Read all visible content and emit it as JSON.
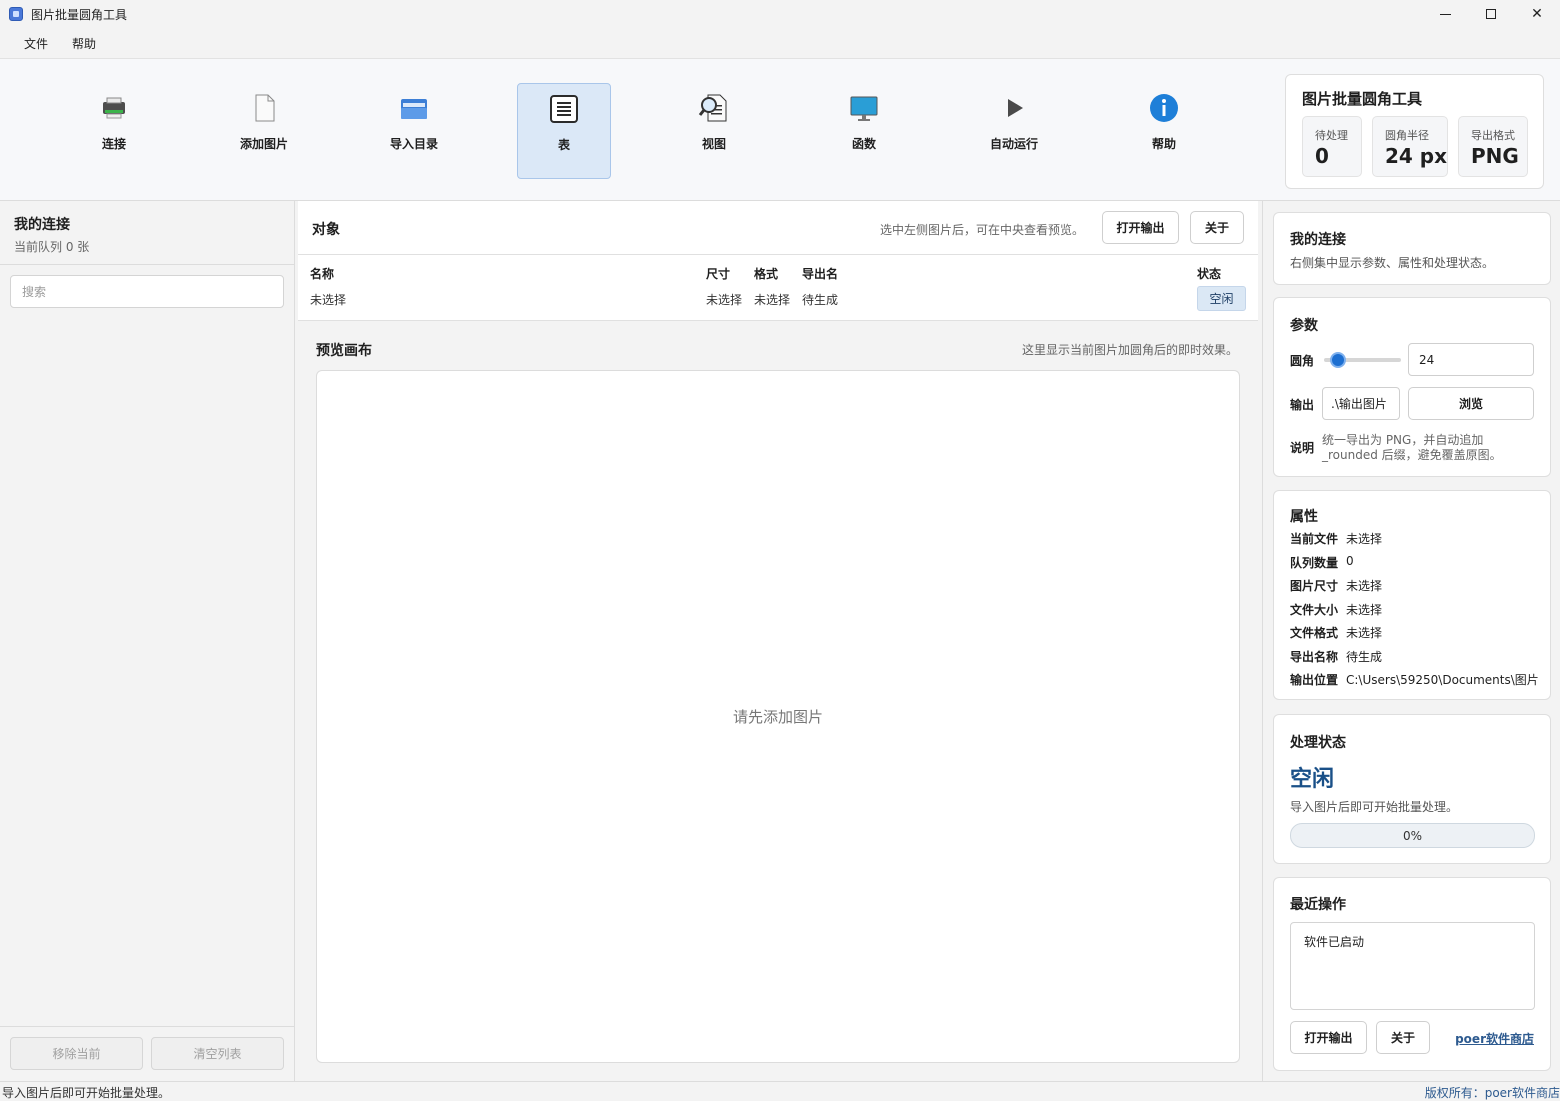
{
  "window": {
    "title": "图片批量圆角工具"
  },
  "menu": [
    "文件",
    "帮助"
  ],
  "toolbar": {
    "items": [
      {
        "label": "连接",
        "icon": "printer-icon"
      },
      {
        "label": "添加图片",
        "icon": "document-icon"
      },
      {
        "label": "导入目录",
        "icon": "folder-icon"
      },
      {
        "label": "表",
        "icon": "table-icon"
      },
      {
        "label": "视图",
        "icon": "magnifier-document-icon"
      },
      {
        "label": "函数",
        "icon": "monitor-icon"
      },
      {
        "label": "自动运行",
        "icon": "play-icon"
      },
      {
        "label": "帮助",
        "icon": "info-icon"
      }
    ],
    "active_index": 3
  },
  "summary": {
    "title": "图片批量圆角工具",
    "stats": [
      {
        "label": "待处理",
        "value": "0"
      },
      {
        "label": "圆角半径",
        "value": "24 px"
      },
      {
        "label": "导出格式",
        "value": "PNG"
      }
    ]
  },
  "left": {
    "title": "我的连接",
    "subtitle": "当前队列 0 张",
    "search_placeholder": "搜索",
    "remove_label": "移除当前",
    "clear_label": "清空列表"
  },
  "objects": {
    "title": "对象",
    "hint": "选中左侧图片后，可在中央查看预览。",
    "open_output_label": "打开输出",
    "about_label": "关于",
    "columns": [
      "名称",
      "尺寸",
      "格式",
      "导出名",
      "状态"
    ],
    "row": {
      "name": "未选择",
      "size": "未选择",
      "format": "未选择",
      "export_name": "待生成",
      "status": "空闲"
    }
  },
  "preview": {
    "title": "预览画布",
    "hint": "这里显示当前图片加圆角后的即时效果。",
    "empty_text": "请先添加图片"
  },
  "right": {
    "conn": {
      "title": "我的连接",
      "subtitle": "右侧集中显示参数、属性和处理状态。"
    },
    "params": {
      "title": "参数",
      "radius_label": "圆角",
      "radius_value": "24",
      "radius_fraction": 0.1,
      "output_label": "输出",
      "output_value": ".\\输出图片",
      "browse_label": "浏览",
      "note_label": "说明",
      "note_line1": "统一导出为 PNG，并自动追加",
      "note_line2": "_rounded 后缀，避免覆盖原图。"
    },
    "props": {
      "title": "属性",
      "items": [
        {
          "k": "当前文件",
          "v": "未选择"
        },
        {
          "k": "队列数量",
          "v": "0"
        },
        {
          "k": "图片尺寸",
          "v": "未选择"
        },
        {
          "k": "文件大小",
          "v": "未选择"
        },
        {
          "k": "文件格式",
          "v": "未选择"
        },
        {
          "k": "导出名称",
          "v": "待生成"
        },
        {
          "k": "输出位置",
          "v": "C:\\Users\\59250\\Documents\\图片"
        }
      ]
    },
    "status": {
      "title": "处理状态",
      "state": "空闲",
      "desc": "导入图片后即可开始批量处理。",
      "progress_text": "0%",
      "progress_value": 0
    },
    "recent": {
      "title": "最近操作",
      "log": "软件已启动",
      "open_output_label": "打开输出",
      "about_label": "关于",
      "store_link": "poer软件商店"
    }
  },
  "statusbar": {
    "left": "导入图片后即可开始批量处理。",
    "right": "版权所有：poer软件商店"
  },
  "colors": {
    "accent": "#1d6fd1",
    "active_tool_bg": "#dbe8f7",
    "status_text": "#1a5088"
  }
}
